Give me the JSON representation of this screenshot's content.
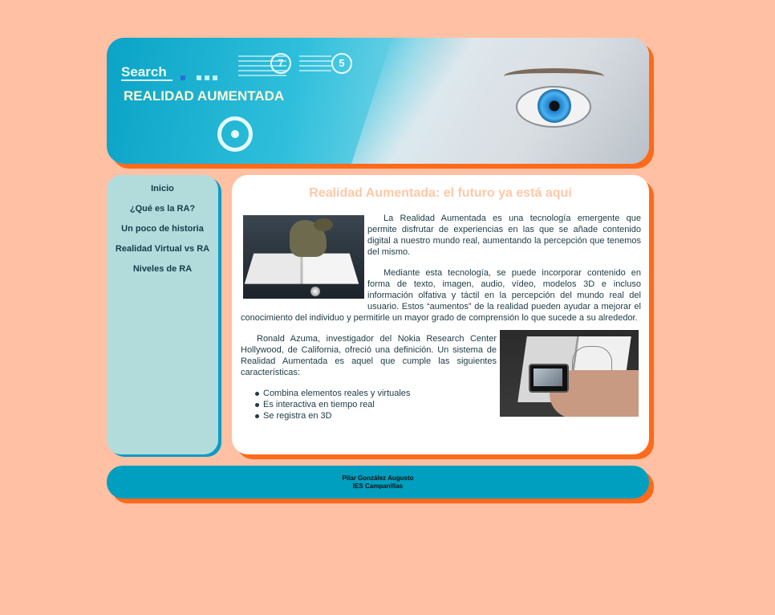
{
  "header": {
    "search_label": "Search",
    "title": "REALIDAD AUMENTADA",
    "badges": [
      "7",
      "5"
    ]
  },
  "sidebar": {
    "items": [
      {
        "label": "Inicio"
      },
      {
        "label": "¿Qué es la RA?"
      },
      {
        "label": "Un poco de historia"
      },
      {
        "label": "Realidad Virtual vs RA"
      },
      {
        "label": "Niveles de RA"
      }
    ]
  },
  "main": {
    "heading": "Realidad Aumentada: el futuro ya está aquí",
    "paragraphs": [
      "La Realidad Aumentada es una tecnología emergente que permite disfrutar de experiencias en las que se añade contenido digital a nuestro mundo real, aumentando la percepción que tenemos del mismo.",
      "Mediante esta tecnología, se puede incorporar contenido en forma de texto, imagen, audio, vídeo, modelos 3D e incluso información olfativa y táctil en la percepción del mundo real del usuario. Estos “aumentos” de la realidad pueden ayudar a mejorar el conocimiento del individuo y permitirle un mayor grado de comprensión lo que sucede a su alrededor.",
      "Ronald Azuma, investigador del Nokia Research Center Hollywood, de California, ofreció una definición. Un sistema de Realidad Aumentada es aquel que cumple las siguientes características:"
    ],
    "features": [
      "Combina elementos reales y virtuales",
      "Es interactiva en tiempo real",
      "Se registra en 3D"
    ]
  },
  "footer": {
    "author": "Pilar González Augusto",
    "school": "IES Campanillas"
  },
  "colors": {
    "background": "#ffc0a3",
    "accent_orange": "#ff6a1a",
    "sidebar_bg": "#b2dcdc",
    "footer_bg": "#009fc0",
    "heading": "#ffc7a6"
  }
}
